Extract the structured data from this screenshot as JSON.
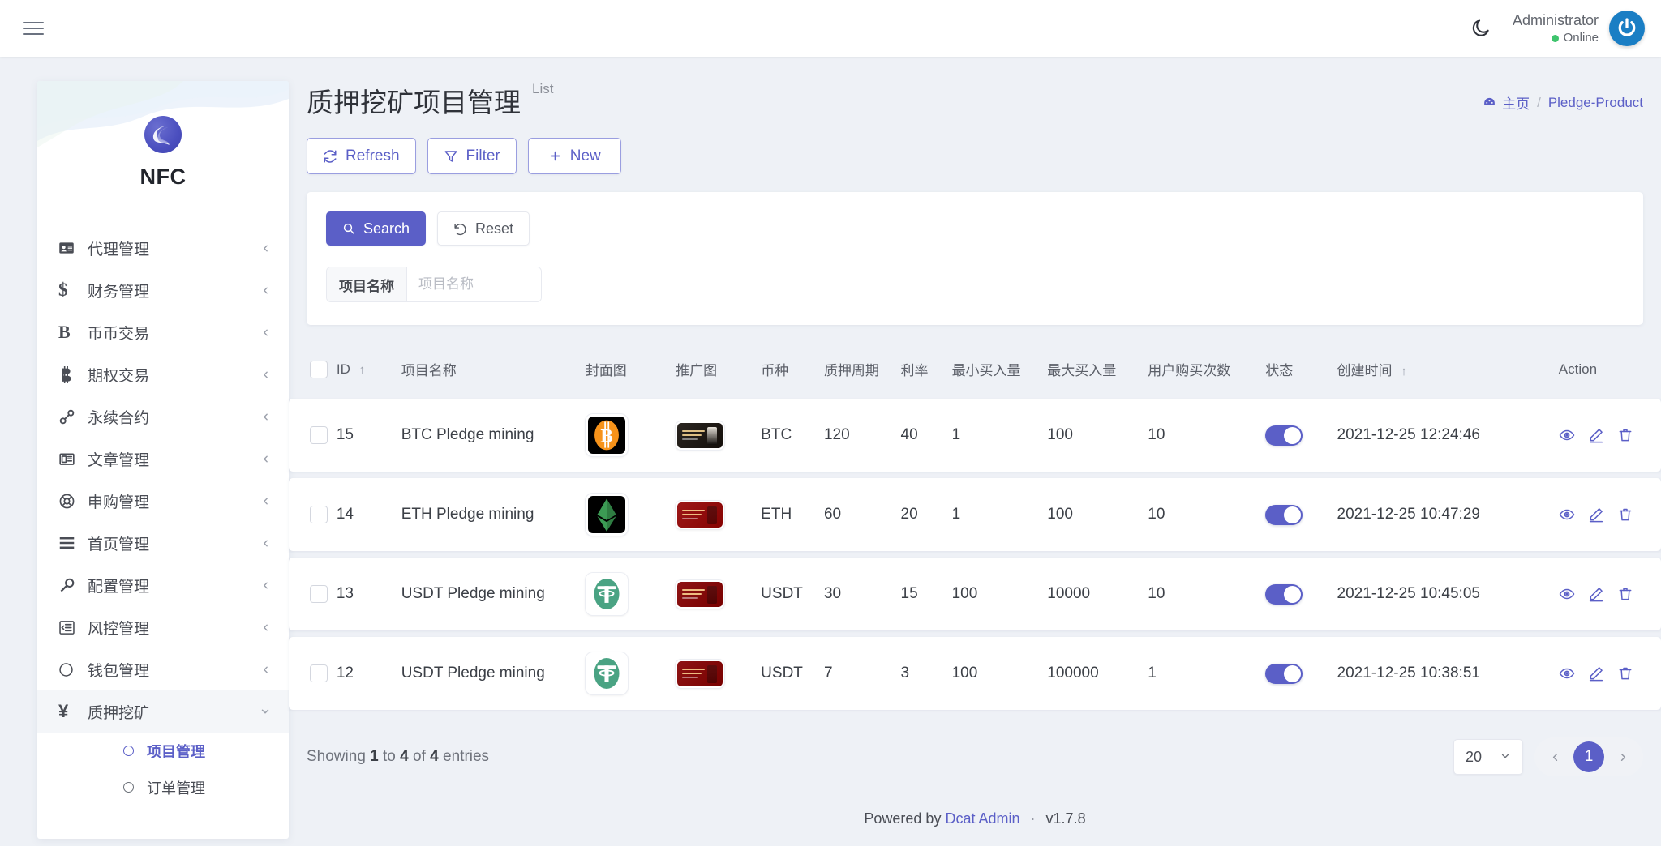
{
  "navbar": {
    "menu_toggle_icon": "hamburger-icon",
    "dark_mode_icon": "moon-icon",
    "user_name": "Administrator",
    "user_status": "Online",
    "avatar_icon": "power-icon"
  },
  "sidebar": {
    "brand_name": "NFC",
    "items": [
      {
        "label": "代理管理",
        "icon": "id-card-icon",
        "arrow": "chevron-left-icon"
      },
      {
        "label": "财务管理",
        "icon": "dollar-icon",
        "arrow": "chevron-left-icon"
      },
      {
        "label": "币币交易",
        "icon": "letter-b-icon",
        "arrow": "chevron-left-icon"
      },
      {
        "label": "期权交易",
        "icon": "bitcoin-b-icon",
        "arrow": "chevron-left-icon"
      },
      {
        "label": "永续合约",
        "icon": "link-icon",
        "arrow": "chevron-left-icon"
      },
      {
        "label": "文章管理",
        "icon": "newspaper-icon",
        "arrow": "chevron-left-icon"
      },
      {
        "label": "申购管理",
        "icon": "lifebuoy-icon",
        "arrow": "chevron-left-icon"
      },
      {
        "label": "首页管理",
        "icon": "bars-icon",
        "arrow": "chevron-left-icon"
      },
      {
        "label": "配置管理",
        "icon": "wrench-icon",
        "arrow": "chevron-left-icon"
      },
      {
        "label": "风控管理",
        "icon": "indent-icon",
        "arrow": "chevron-left-icon"
      },
      {
        "label": "钱包管理",
        "icon": "circle-icon",
        "arrow": "chevron-left-icon"
      },
      {
        "label": "质押挖矿",
        "icon": "yen-icon",
        "arrow": "chevron-down-icon",
        "expanded": true
      }
    ],
    "submenu": [
      {
        "label": "项目管理",
        "active": true
      },
      {
        "label": "订单管理",
        "active": false
      }
    ]
  },
  "page": {
    "title": "质押挖矿项目管理",
    "subtitle": "List",
    "breadcrumb": {
      "home_icon": "dashboard-icon",
      "home": "主页",
      "separator": "/",
      "current": "Pledge-Product"
    }
  },
  "toolbar": {
    "refresh_label": "Refresh",
    "refresh_icon": "refresh-icon",
    "filter_label": "Filter",
    "filter_icon": "funnel-icon",
    "new_label": "New",
    "new_icon": "plus-icon"
  },
  "filter": {
    "search_label": "Search",
    "search_icon": "search-icon",
    "reset_label": "Reset",
    "reset_icon": "undo-icon",
    "field_label": "项目名称",
    "field_value": "",
    "field_placeholder": "项目名称"
  },
  "table": {
    "select_all_icon": "checkbox-icon",
    "columns": [
      {
        "key": "checkbox",
        "label": ""
      },
      {
        "key": "id",
        "label": "ID",
        "sort": "↑"
      },
      {
        "key": "name",
        "label": "项目名称"
      },
      {
        "key": "cover",
        "label": "封面图"
      },
      {
        "key": "promo",
        "label": "推广图"
      },
      {
        "key": "coin",
        "label": "币种"
      },
      {
        "key": "period",
        "label": "质押周期"
      },
      {
        "key": "rate",
        "label": "利率"
      },
      {
        "key": "min",
        "label": "最小买入量"
      },
      {
        "key": "max",
        "label": "最大买入量"
      },
      {
        "key": "times",
        "label": "用户购买次数"
      },
      {
        "key": "status",
        "label": "状态"
      },
      {
        "key": "time",
        "label": "创建时间",
        "sort": "↑"
      },
      {
        "key": "action",
        "label": "Action"
      }
    ],
    "rows": [
      {
        "id": "15",
        "name": "BTC Pledge mining",
        "cover_icon": "bitcoin-coin-logo",
        "cover_bg": "#000000",
        "cover_fg": "#f7931a",
        "promo_icon": "promo-banner-dark",
        "promo_bg": "#2a2520",
        "promo_fig": "#e8e3da",
        "coin": "BTC",
        "period": "120",
        "rate": "40",
        "min": "1",
        "max": "100",
        "times": "10",
        "status_on": true,
        "time": "2021-12-25 12:24:46"
      },
      {
        "id": "14",
        "name": "ETH Pledge mining",
        "cover_icon": "ethereum-coin-logo",
        "cover_bg": "#000000",
        "cover_fg": "#3c9b54",
        "promo_icon": "promo-banner-red",
        "promo_bg": "#9c1818",
        "promo_fig": "#5e0d0d",
        "coin": "ETH",
        "period": "60",
        "rate": "20",
        "min": "1",
        "max": "100",
        "times": "10",
        "status_on": true,
        "time": "2021-12-25 10:47:29"
      },
      {
        "id": "13",
        "name": "USDT Pledge mining",
        "cover_icon": "tether-coin-logo",
        "cover_bg": "#ffffff",
        "cover_fg": "#4aa383",
        "promo_icon": "promo-banner-red",
        "promo_bg": "#8e1414",
        "promo_fig": "#5e0d0d",
        "coin": "USDT",
        "period": "30",
        "rate": "15",
        "min": "100",
        "max": "10000",
        "times": "10",
        "status_on": true,
        "time": "2021-12-25 10:45:05"
      },
      {
        "id": "12",
        "name": "USDT Pledge mining",
        "cover_icon": "tether-coin-logo",
        "cover_bg": "#ffffff",
        "cover_fg": "#4aa383",
        "promo_icon": "promo-banner-red",
        "promo_bg": "#8e1414",
        "promo_fig": "#5e0d0d",
        "coin": "USDT",
        "period": "7",
        "rate": "3",
        "min": "100",
        "max": "100000",
        "times": "1",
        "status_on": true,
        "time": "2021-12-25 10:38:51"
      }
    ],
    "action_icons": [
      "eye-icon",
      "pencil-icon",
      "trash-icon"
    ]
  },
  "pagination": {
    "info_prefix": "Showing",
    "from": "1",
    "info_mid_1": "to",
    "to": "4",
    "info_mid_2": "of",
    "total": "4",
    "info_suffix": "entries",
    "per_page": "20",
    "per_page_icon": "chevron-down-icon",
    "prev_icon": "chevron-left-icon",
    "next_icon": "chevron-right-icon",
    "current_page": "1"
  },
  "footer": {
    "powered_by": "Powered by",
    "brand": "Dcat Admin",
    "separator": "·",
    "version": "v1.7.8"
  },
  "colors": {
    "accent": "#5b5fc7",
    "page_bg": "#eef1f6",
    "online": "#3ec46d",
    "avatar": "#1a7ec4"
  }
}
